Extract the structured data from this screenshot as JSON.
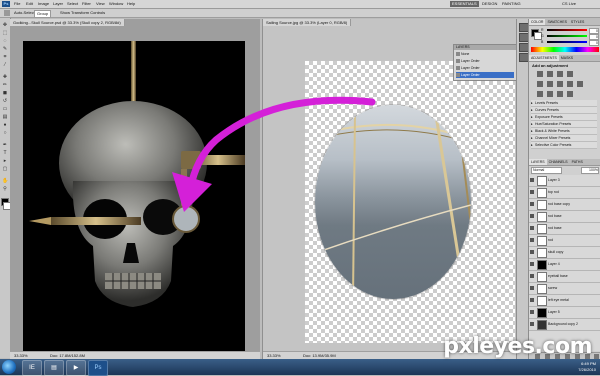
{
  "app": {
    "logo": "Ps",
    "menus": [
      "File",
      "Edit",
      "Image",
      "Layer",
      "Select",
      "Filter",
      "View",
      "Window",
      "Help"
    ],
    "workspaces": [
      "ESSENTIALS",
      "DESIGN",
      "PAINTING"
    ],
    "active_workspace": "ESSENTIALS",
    "search_label": "CS Live"
  },
  "options_bar": {
    "auto_select_label": "Auto-Select:",
    "auto_select_value": "Group",
    "show_transform_label": "Show Transform Controls"
  },
  "documents": [
    {
      "tab_title": "Godking...Skull Source.psd @ 33.3% (Skull copy 2, RGB/8#)",
      "zoom": "33.33%",
      "doc_size": "Doc: 17.8M/152.8M"
    },
    {
      "tab_title": "Sailing Source.jpg @ 33.3% (Layer 0, RGB/8)",
      "zoom": "33.33%",
      "doc_size": "Doc: 13.9M/35.9M"
    }
  ],
  "floating_layers": {
    "header": "LAYERS",
    "rows": [
      {
        "name": "None",
        "selected": false
      },
      {
        "name": "Layer Order",
        "selected": false
      },
      {
        "name": "Layer Order",
        "selected": false
      },
      {
        "name": "Layer Order",
        "selected": true
      }
    ]
  },
  "color_panel": {
    "tabs": [
      "COLOR",
      "SWATCHES",
      "STYLES"
    ],
    "r": "0",
    "g": "0",
    "b": "0"
  },
  "adjustments_panel": {
    "tabs": [
      "ADJUSTMENTS",
      "MASKS"
    ],
    "title": "Add an adjustment",
    "presets": [
      "Levels Presets",
      "Curves Presets",
      "Exposure Presets",
      "Hue/Saturation Presets",
      "Black & White Presets",
      "Channel Mixer Presets",
      "Selective Color Presets"
    ]
  },
  "layers_panel": {
    "tabs": [
      "LAYERS",
      "CHANNELS",
      "PATHS"
    ],
    "blend_mode": "Normal",
    "opacity": "100%",
    "layers": [
      "Layer 3",
      "top rod",
      "rod base copy",
      "rod base",
      "rod base",
      "rod",
      "skull copy",
      "Layer 4",
      "eyeball base",
      "screw",
      "left eye metal",
      "Layer 5",
      "Background copy 2"
    ]
  },
  "taskbar": {
    "items": [
      "IE",
      "Explorer",
      "Media",
      "Ps"
    ],
    "time": "6:49 PM",
    "date": "7/26/2010"
  },
  "watermark": "pxleyes.com",
  "colors": {
    "arrow": "#d420d8",
    "menubar": "#d6d6d6",
    "panel": "#d0d0d0",
    "selection": "#3a6fc6"
  }
}
